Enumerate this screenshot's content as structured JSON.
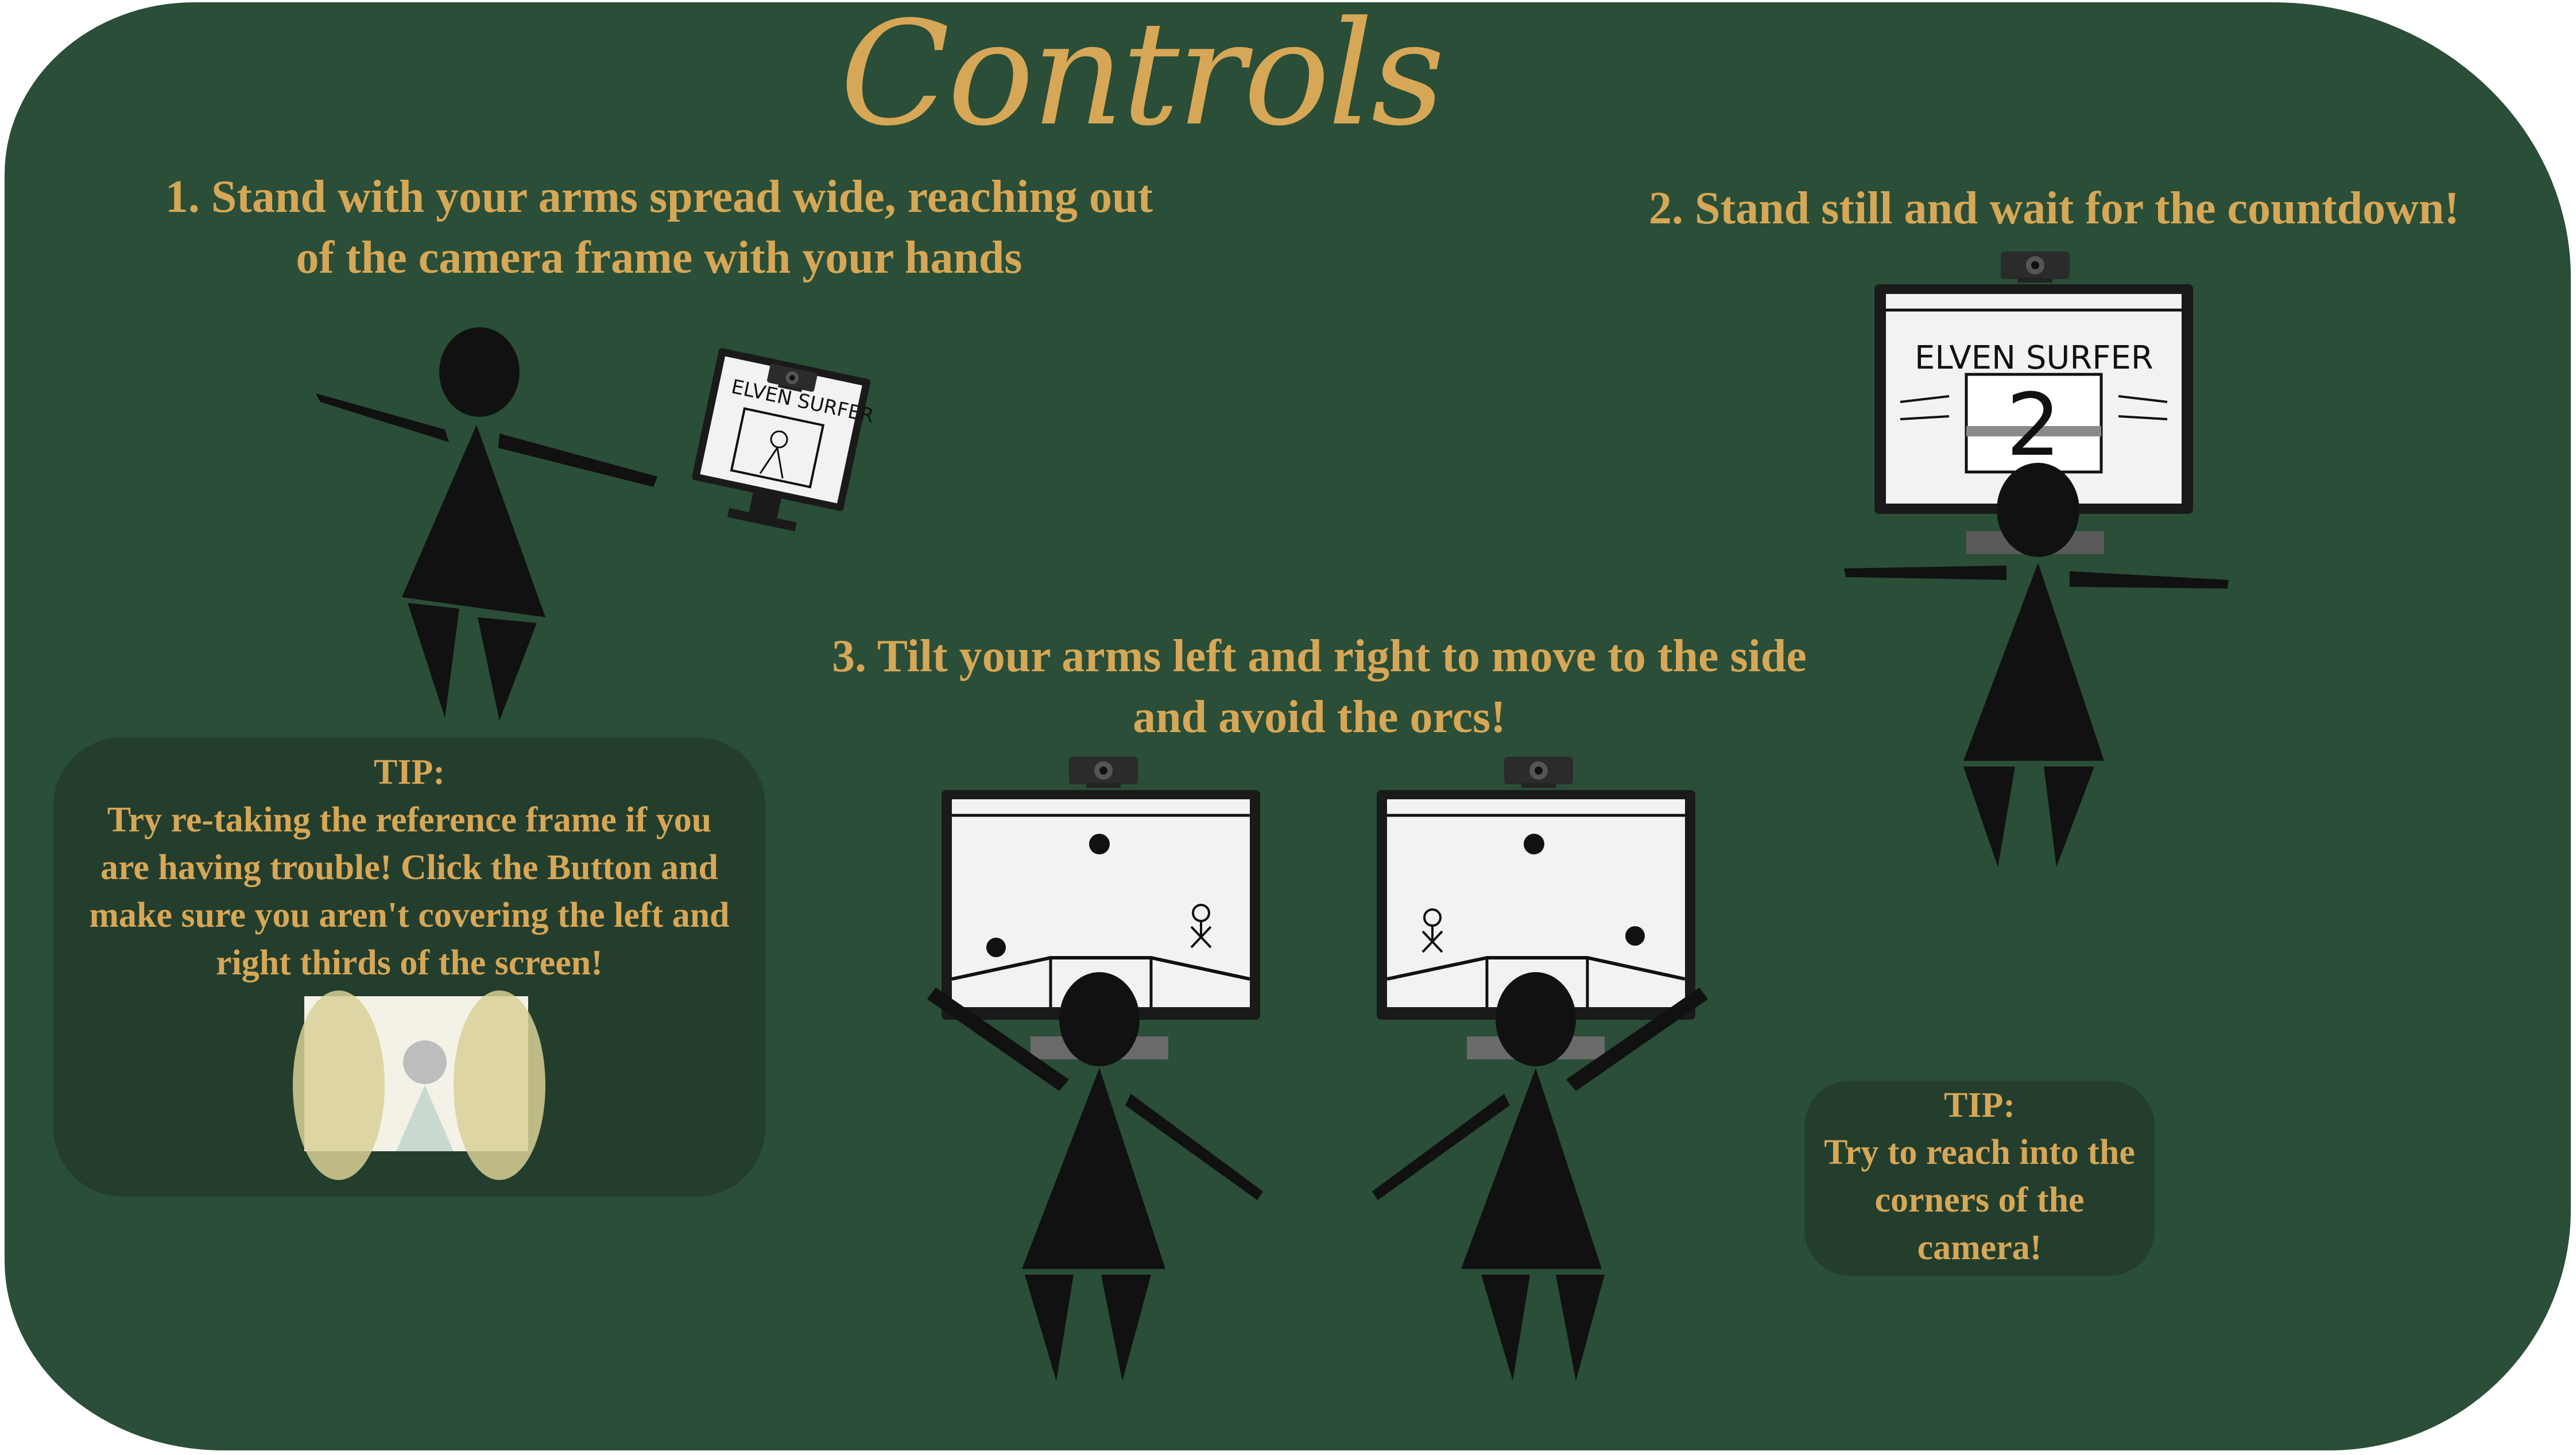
{
  "title": "Controls",
  "steps": {
    "step1": "1. Stand with your arms spread wide, reaching out of the camera frame with your hands",
    "step2": "2. Stand still and wait for the countdown!",
    "step3": "3. Tilt your arms left and right to move to the side and avoid the orcs!"
  },
  "tip_left": {
    "heading": "TIP:",
    "text": "Try re-taking the reference frame if you are having trouble! Click the Button and make sure you aren't covering the left and right thirds of the screen!"
  },
  "tip_right": {
    "heading": "TIP:",
    "text": "Try to reach into the corners of the camera!"
  },
  "screen_title": "ELVEN SURFER",
  "countdown": "2",
  "colors": {
    "background": "#2a4e37",
    "accent": "#d6a756",
    "figure": "#111111"
  }
}
